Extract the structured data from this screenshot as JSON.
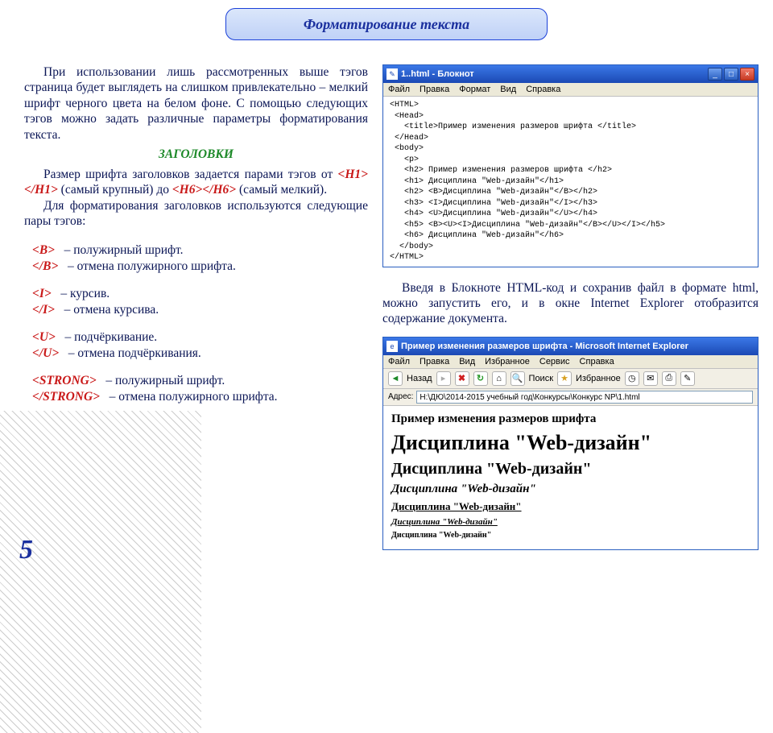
{
  "title": "Форматирование текста",
  "page_number": "5",
  "left": {
    "intro": "При использовании лишь рассмотренных выше тэгов страница будет выглядеть на слишком привлекательно – мелкий шрифт черного цвета на белом фоне. С помощью следующих тэгов можно задать различные параметры форматирования текста.",
    "sub1": "ЗАГОЛОВКИ",
    "p2a": "Размер шрифта заголовков задается парами тэгов от ",
    "h1open": "<H1>",
    "h1close": "</H1>",
    "p2b": " (самый крупный) до ",
    "h6open": "<H6>",
    "h6close": "</H6>",
    "p2c": " (самый мелкий).",
    "p3": "Для форматирования заголовков используются следующие пары тэгов:",
    "tags": {
      "b_open": "<B>",
      "b_open_d": " – полужирный шрифт.",
      "b_close": "</B>",
      "b_close_d": " – отмена полужирного шрифта.",
      "i_open": "<I>",
      "i_open_d": " – курсив.",
      "i_close": "</I>",
      "i_close_d": " – отмена курсива.",
      "u_open": "<U>",
      "u_open_d": " – подчёркивание.",
      "u_close": "</U>",
      "u_close_d": " – отмена подчёркивания.",
      "s_open": "<STRONG>",
      "s_open_d": " – полужирный шрифт.",
      "s_close": "</STRONG>",
      "s_close_d": " –  отмена полужирного шрифта."
    }
  },
  "notepad": {
    "title": "1..html - Блокнот",
    "menu": [
      "Файл",
      "Правка",
      "Формат",
      "Вид",
      "Справка"
    ],
    "code": "<HTML>\n <Head>\n   <title>Пример изменения размеров шрифта </title>\n </Head>\n <body>\n   <p>\n   <h2> Пример изменения размеров шрифта </h2>\n   <h1> Дисциплина \"Web-дизайн\"</h1>\n   <h2> <B>Дисциплина \"Web-дизайн\"</B></h2>\n   <h3> <I>Дисциплина \"Web-дизайн\"</I></h3>\n   <h4> <U>Дисциплина \"Web-дизайн\"</U></h4>\n   <h5> <B><U><I>Дисциплина \"Web-дизайн\"</B></U></I></h5>\n   <h6> Дисциплина \"Web-дизайн\"</h6>\n  </body>\n</HTML>"
  },
  "mid_para": "Введя в Блокноте HTML-код  и сохранив файл в формате html, можно запустить его, и в окне Internet Explorer отобразится содержание документа.",
  "ie": {
    "title": "Пример изменения размеров шрифта - Microsoft Internet Explorer",
    "menu": [
      "Файл",
      "Правка",
      "Вид",
      "Избранное",
      "Сервис",
      "Справка"
    ],
    "back": "Назад",
    "search": "Поиск",
    "fav": "Избранное",
    "addr_label": "Адрес:",
    "addr_value": "H:\\ДЮ\\2014-2015 учебный год\\Конкурсы\\Конкурс NP\\1.html",
    "h2s": "Пример изменения размеров шрифта",
    "h1": "Дисциплина \"Web-дизайн\"",
    "h2": "Дисциплина \"Web-дизайн\"",
    "h3": "Дисциплина \"Web-дизайн\"",
    "h4": "Дисциплина \"Web-дизайн\"",
    "h5": "Дисциплина \"Web-дизайн\"",
    "h6": "Дисциплина \"Web-дизайн\""
  }
}
